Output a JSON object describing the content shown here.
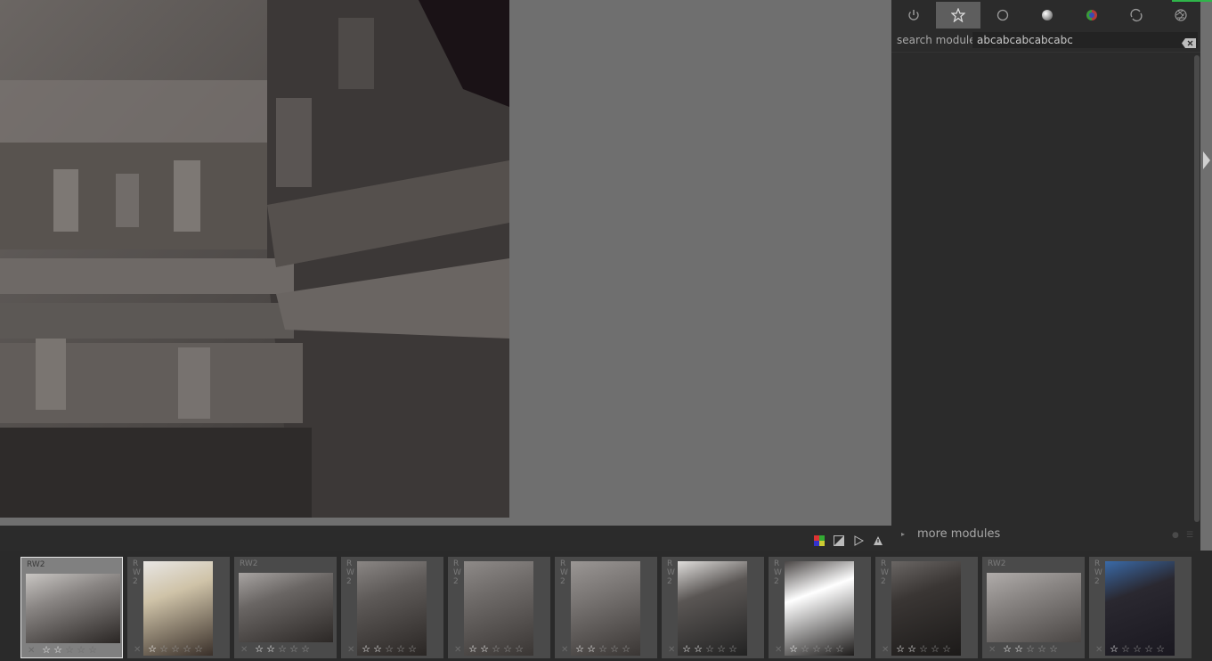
{
  "right_panel": {
    "tabs": [
      {
        "icon": "power-icon",
        "active": false
      },
      {
        "icon": "favorite-star-icon",
        "active": true
      },
      {
        "icon": "circle-base-icon",
        "active": false
      },
      {
        "icon": "tone-sphere-icon",
        "active": false
      },
      {
        "icon": "color-icon",
        "active": false
      },
      {
        "icon": "correct-icon",
        "active": false
      },
      {
        "icon": "effects-aperture-icon",
        "active": false
      }
    ],
    "search_label": "search module",
    "search_value": "abcabcabcabcabc",
    "more_modules_label": "more modules"
  },
  "filmstrip": {
    "thumbnails": [
      {
        "ext": "RW2",
        "stars": 2,
        "selected": true
      },
      {
        "ext": "RW2",
        "stars": 1,
        "selected": false
      },
      {
        "ext": "RW2",
        "stars": 2,
        "selected": false
      },
      {
        "ext": "RW2",
        "stars": 2,
        "selected": false
      },
      {
        "ext": "RW2",
        "stars": 2,
        "selected": false
      },
      {
        "ext": "RW2",
        "stars": 2,
        "selected": false
      },
      {
        "ext": "RW2",
        "stars": 2,
        "selected": false
      },
      {
        "ext": "RW2",
        "stars": 1,
        "selected": false
      },
      {
        "ext": "RW2",
        "stars": 2,
        "selected": false
      },
      {
        "ext": "RW2",
        "stars": 2,
        "selected": false
      },
      {
        "ext": "RW2",
        "stars": 1,
        "selected": false
      }
    ]
  },
  "colors": {
    "accent_green": "#2fb54a",
    "panel_bg": "#2b2b2b",
    "center_bg": "#6f6f6f"
  }
}
